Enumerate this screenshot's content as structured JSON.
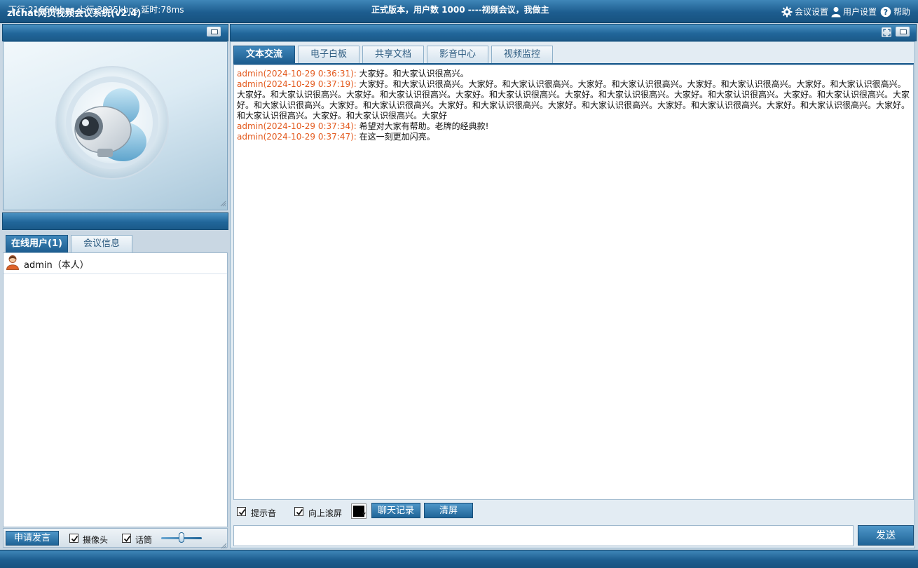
{
  "app": {
    "title": "zlchat网页视频会议系统(v2.4)",
    "menu": {
      "meeting_settings": "会议设置",
      "user_settings": "用户设置",
      "help": "帮助"
    }
  },
  "left": {
    "tabs": [
      {
        "label": "在线用户(1)",
        "active": true
      },
      {
        "label": "会议信息",
        "active": false
      }
    ],
    "users": [
      {
        "name": "admin（本人）",
        "icon": "user-icon"
      }
    ],
    "controls": {
      "request_speak": "申请发言",
      "camera_label": "摄像头",
      "camera_checked": true,
      "mic_label": "话筒",
      "mic_checked": true,
      "volume_level": 0.5
    }
  },
  "main": {
    "tabs": [
      {
        "label": "文本交流",
        "active": true
      },
      {
        "label": "电子白板",
        "active": false
      },
      {
        "label": "共享文档",
        "active": false
      },
      {
        "label": "影音中心",
        "active": false
      },
      {
        "label": "视频监控",
        "active": false
      }
    ],
    "messages": [
      {
        "sender": "admin(2024-10-29 0:36:31):",
        "text": " 大家好。和大家认识很高兴。"
      },
      {
        "sender": "admin(2024-10-29 0:37:19):",
        "text": " 大家好。和大家认识很高兴。大家好。和大家认识很高兴。大家好。和大家认识很高兴。大家好。和大家认识很高兴。大家好。和大家认识很高兴。大家好。和大家认识很高兴。大家好。和大家认识很高兴。大家好。和大家认识很高兴。大家好。和大家认识很高兴。大家好。和大家认识很高兴。大家好。和大家认识很高兴。大家好。和大家认识很高兴。大家好。和大家认识很高兴。大家好。和大家认识很高兴。大家好。和大家认识很高兴。大家好。和大家认识很高兴。大家好。和大家认识很高兴。大家好。和大家认识很高兴。大家好。和大家认识很高兴。大家好"
      },
      {
        "sender": "admin(2024-10-29 0:37:34):",
        "text": " 希望对大家有帮助。老牌的经典款!"
      },
      {
        "sender": "admin(2024-10-29 0:37:47):",
        "text": " 在这一刻更加闪亮。"
      }
    ],
    "toolbar": {
      "sound_label": "提示音",
      "sound_checked": true,
      "scroll_label": "向上滚屏",
      "scroll_checked": true,
      "font_color": "#000000",
      "history_button": "聊天记录",
      "clear_button": "清屏"
    },
    "input": {
      "value": ""
    },
    "send_button": "发送"
  },
  "status": {
    "left": "下行:21660kbps  上行:3835kbps  延时:78ms",
    "center": "正式版本，用户数 1000 ----视频会议，我做主"
  },
  "colors": {
    "accent": "#1d5d8f",
    "sender": "#e35b1f"
  }
}
